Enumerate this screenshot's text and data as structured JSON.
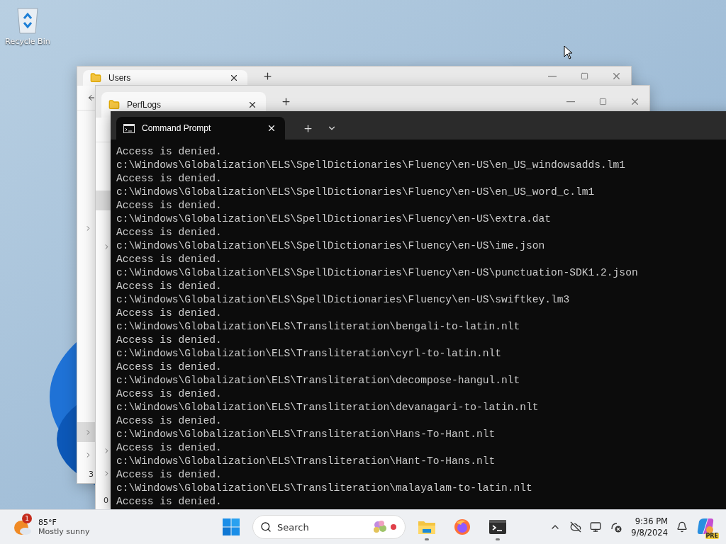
{
  "desktop": {
    "icons": [
      {
        "label": "Recycle Bin"
      }
    ]
  },
  "windows": [
    {
      "kind": "explorer",
      "tab": "Users",
      "nav_items": [
        {
          "expandable": true,
          "selected": false
        },
        {
          "expandable": true,
          "selected": true
        },
        {
          "expandable": true,
          "selected": false
        }
      ],
      "status_text": "3"
    },
    {
      "kind": "explorer",
      "tab": "PerfLogs",
      "nav_items": [
        {
          "expandable": false,
          "selected": true
        },
        {
          "expandable": true,
          "selected": false
        },
        {
          "expandable": true,
          "selected": false
        },
        {
          "expandable": true,
          "selected": false
        }
      ],
      "status_text": "0"
    },
    {
      "kind": "terminal",
      "tab": "Command Prompt",
      "lines": [
        "Access is denied.",
        "c:\\Windows\\Globalization\\ELS\\SpellDictionaries\\Fluency\\en-US\\en_US_windowsadds.lm1",
        "Access is denied.",
        "c:\\Windows\\Globalization\\ELS\\SpellDictionaries\\Fluency\\en-US\\en_US_word_c.lm1",
        "Access is denied.",
        "c:\\Windows\\Globalization\\ELS\\SpellDictionaries\\Fluency\\en-US\\extra.dat",
        "Access is denied.",
        "c:\\Windows\\Globalization\\ELS\\SpellDictionaries\\Fluency\\en-US\\ime.json",
        "Access is denied.",
        "c:\\Windows\\Globalization\\ELS\\SpellDictionaries\\Fluency\\en-US\\punctuation-SDK1.2.json",
        "Access is denied.",
        "c:\\Windows\\Globalization\\ELS\\SpellDictionaries\\Fluency\\en-US\\swiftkey.lm3",
        "Access is denied.",
        "c:\\Windows\\Globalization\\ELS\\Transliteration\\bengali-to-latin.nlt",
        "Access is denied.",
        "c:\\Windows\\Globalization\\ELS\\Transliteration\\cyrl-to-latin.nlt",
        "Access is denied.",
        "c:\\Windows\\Globalization\\ELS\\Transliteration\\decompose-hangul.nlt",
        "Access is denied.",
        "c:\\Windows\\Globalization\\ELS\\Transliteration\\devanagari-to-latin.nlt",
        "Access is denied.",
        "c:\\Windows\\Globalization\\ELS\\Transliteration\\Hans-To-Hant.nlt",
        "Access is denied.",
        "c:\\Windows\\Globalization\\ELS\\Transliteration\\Hant-To-Hans.nlt",
        "Access is denied.",
        "c:\\Windows\\Globalization\\ELS\\Transliteration\\malayalam-to-latin.nlt",
        "Access is denied."
      ]
    }
  ],
  "taskbar": {
    "weather": {
      "badge": "1",
      "temperature": "85°F",
      "condition": "Mostly sunny"
    },
    "search": {
      "placeholder": "Search"
    },
    "apps": [
      {
        "kind": "explorer",
        "running": true
      },
      {
        "kind": "browser",
        "running": false
      },
      {
        "kind": "terminal",
        "running": true
      }
    ],
    "clock": {
      "time": "9:36 PM",
      "date": "9/8/2024"
    },
    "copilot_badge": "PRE"
  }
}
